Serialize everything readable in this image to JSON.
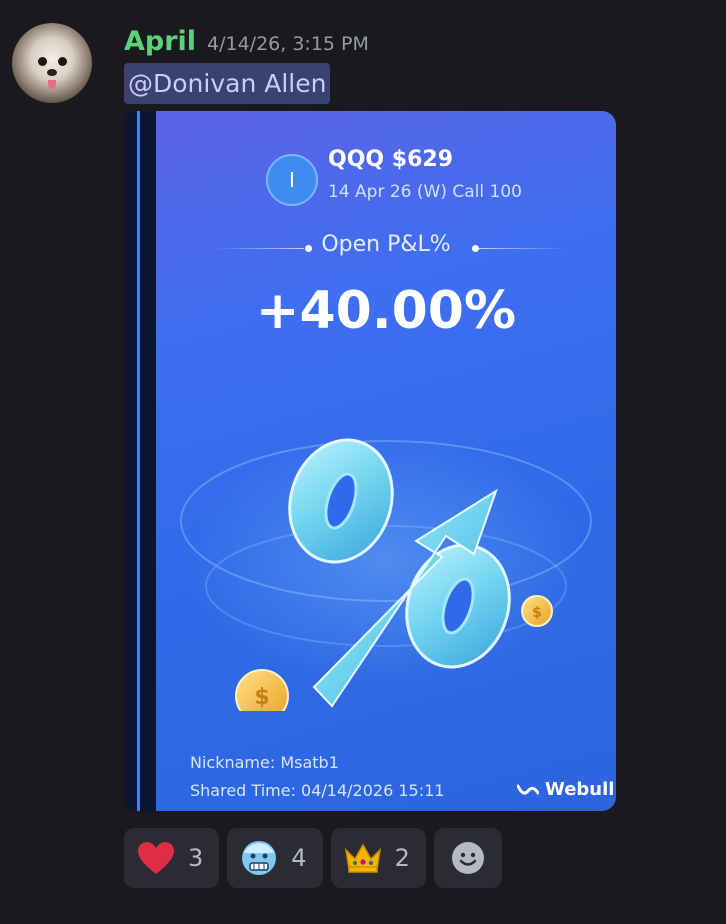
{
  "message": {
    "author": "April",
    "timestamp": "4/14/26, 3:15 PM",
    "mention": "@Donivan Allen"
  },
  "card": {
    "ticker_letter": "I",
    "ticker": "QQQ $629",
    "contract": "14 Apr 26 (W) Call 100",
    "pl_label": "Open P&L%",
    "pl_value": "+40.00%",
    "nickname": "Nickname: Msatb1",
    "shared_time": "Shared Time: 04/14/2026 15:11",
    "brand": "Webull"
  },
  "reactions": [
    {
      "icon": "heart-icon",
      "count": "3"
    },
    {
      "icon": "freezing-face-icon",
      "count": "4"
    },
    {
      "icon": "crown-icon",
      "count": "2"
    }
  ],
  "colors": {
    "background": "#1a1a1e",
    "username": "#5ad27a",
    "mention_bg": "#3c4270",
    "card_gradient_start": "#5c63e6",
    "card_gradient_end": "#2c64de",
    "reaction_bg": "#2b2c33"
  }
}
